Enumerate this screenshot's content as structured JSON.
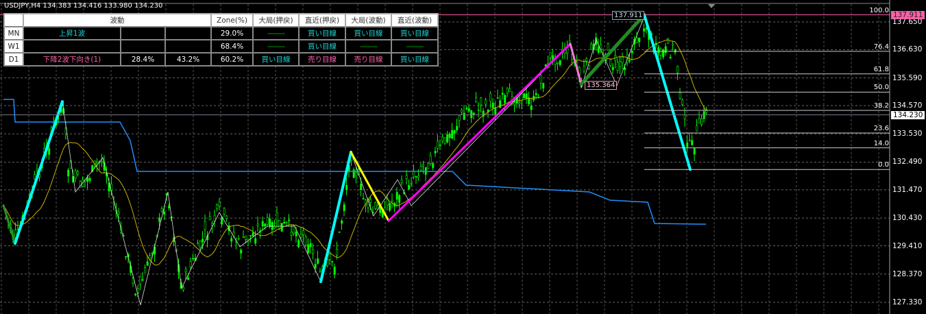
{
  "header": {
    "symbol_info": "USDJPY,H4  134.383 134.416 133.980 134.230"
  },
  "table": {
    "headers": [
      "",
      "波動",
      "Zone(%)",
      "大局(押戻)",
      "直近(押戻)",
      "大局(波動)",
      "直近(波動)"
    ],
    "rows": [
      {
        "tf": "MN",
        "wave": "上昇1波",
        "c1": "",
        "c2": "",
        "zone": "29.0%",
        "major_pull": "---------",
        "recent_pull": "買い目線",
        "major_wave": "買い目線",
        "recent_wave": "買い目線"
      },
      {
        "tf": "W1",
        "wave": "",
        "c1": "",
        "c2": "",
        "zone": "68.4%",
        "major_pull": "---------",
        "recent_pull": "買い目線",
        "major_wave": "---------",
        "recent_wave": "---------"
      },
      {
        "tf": "D1",
        "wave": "下降2波下向き(1)",
        "c1": "28.4%",
        "c2": "43.2%",
        "zone": "60.2%",
        "major_pull": "買い目線",
        "recent_pull": "売り目線",
        "major_wave": "売り目線",
        "recent_wave": "買い目線"
      }
    ]
  },
  "colors": {
    "background": "#000000",
    "candle": "#00ff00",
    "buy_text": "#1fd3d3",
    "sell_text": "#ff5fa8",
    "ma": "#c8b400",
    "support_line": "#1e90ff",
    "high_line": "#ff5fa8"
  },
  "chart_data": {
    "type": "candlestick",
    "symbol": "USDJPY",
    "timeframe": "H4",
    "ylim": [
      127.0,
      138.2
    ],
    "y_ticks": [
      "137.650",
      "136.630",
      "135.590",
      "134.570",
      "133.530",
      "132.490",
      "131.470",
      "130.430",
      "129.410",
      "128.370",
      "127.330"
    ],
    "current_price": "134.230",
    "high_marker": "137.911",
    "low_marker": "135.364",
    "fibonacci": {
      "high": 137.911,
      "low": 132.22,
      "levels": [
        "100.0",
        "76.4",
        "61.8",
        "50.0",
        "38.2",
        "23.6",
        "14.0",
        "0.0"
      ]
    },
    "zigzag_legs": [
      {
        "color": "#2e8b2e",
        "from": 130.9,
        "to": 129.5
      },
      {
        "color": "#00ffff",
        "from": 129.5,
        "to": 134.72
      },
      {
        "color": "#00ffff",
        "from": 128.09,
        "to": 132.86
      },
      {
        "color": "#ffff00",
        "from": 132.86,
        "to": 130.33
      },
      {
        "color": "#ff00ff",
        "from": 130.33,
        "to": 136.84
      },
      {
        "color": "#ff77dd",
        "from": 136.84,
        "to": 135.364
      },
      {
        "color": "#228b22",
        "from": 135.364,
        "to": 137.911
      },
      {
        "color": "#00ffff",
        "from": 137.911,
        "to": 132.22
      }
    ]
  }
}
